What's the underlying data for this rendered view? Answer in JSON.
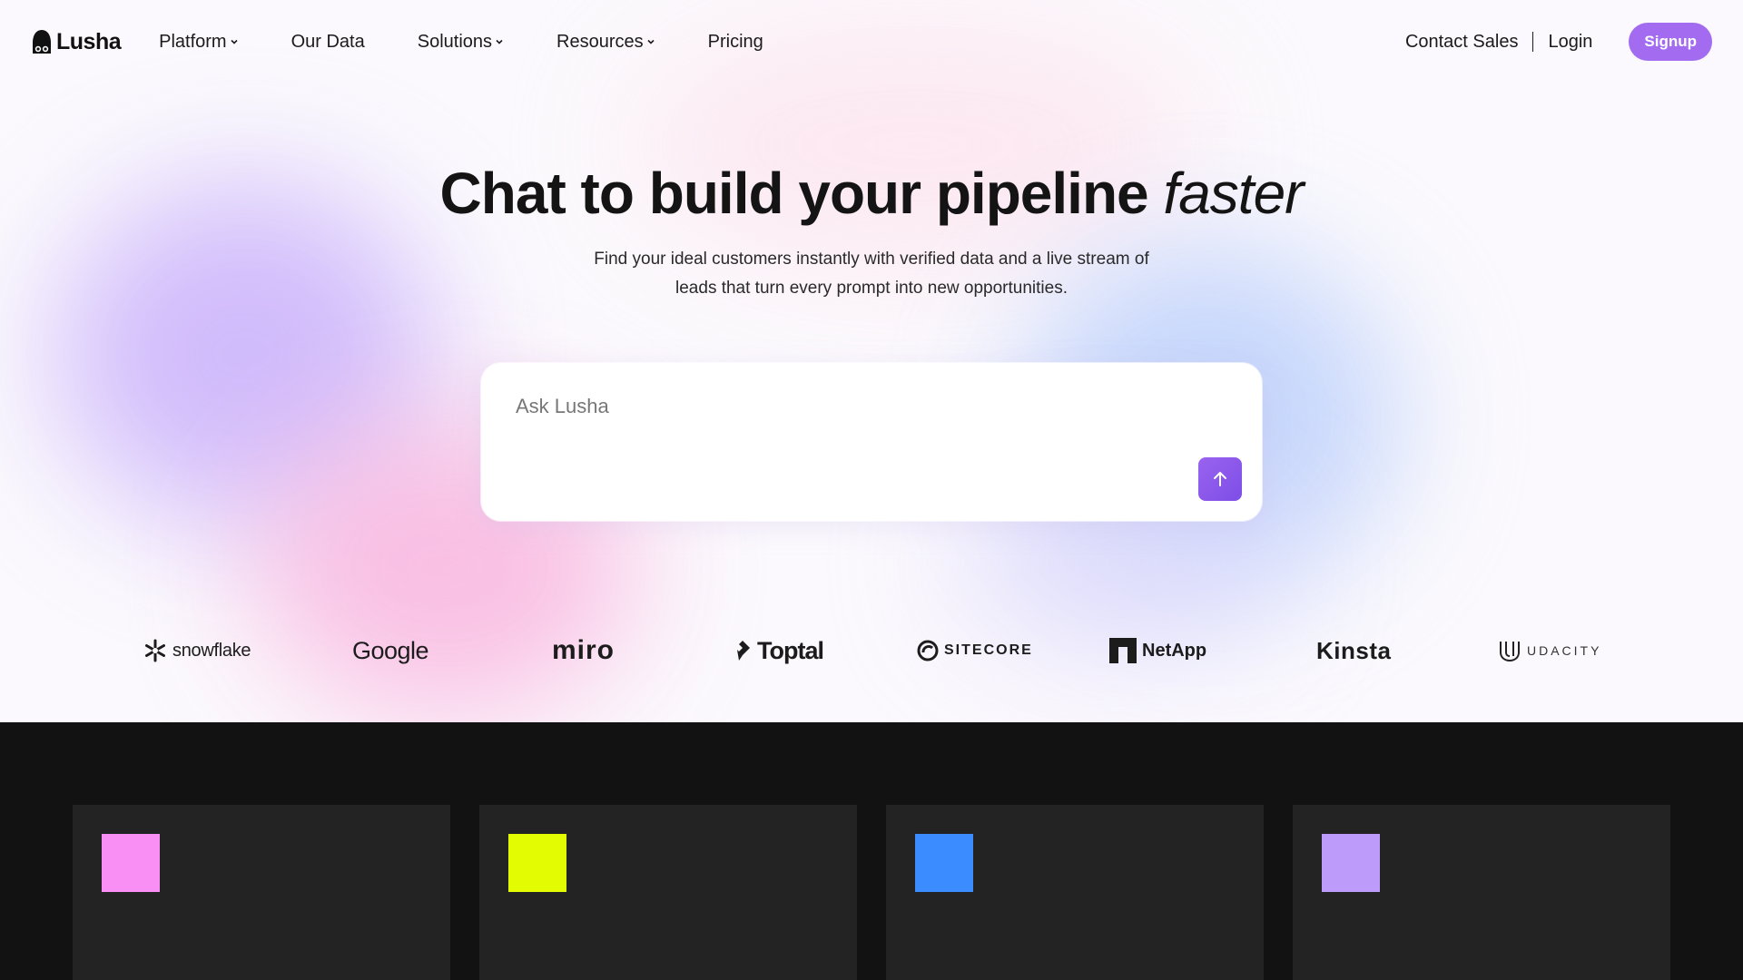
{
  "brand": {
    "name": "Lusha",
    "accent": "#a36bf0"
  },
  "nav": {
    "items": [
      {
        "label": "Platform",
        "dropdown": true
      },
      {
        "label": "Our Data",
        "dropdown": false
      },
      {
        "label": "Solutions",
        "dropdown": true
      },
      {
        "label": "Resources",
        "dropdown": true
      },
      {
        "label": "Pricing",
        "dropdown": false
      }
    ],
    "contact_sales": "Contact Sales",
    "login": "Login",
    "signup": "Signup"
  },
  "hero": {
    "headline": "Chat to build your pipeline",
    "headline_emphasis": "faster",
    "subtitle_line1": "Find your ideal customers instantly with verified data and a live stream of",
    "subtitle_line2": "leads that turn every prompt into new opportunities."
  },
  "chat": {
    "placeholder": "Ask Lusha",
    "send_icon": "arrow-up-icon"
  },
  "customer_logos": [
    "snowflake",
    "Google",
    "miro",
    "Toptal",
    "SITECORE",
    "NetApp",
    "Kinsta",
    "UDACITY"
  ],
  "feature_cards": [
    {
      "swatch_color": "#f98ef5"
    },
    {
      "swatch_color": "#e3fc02"
    },
    {
      "swatch_color": "#3b8cff"
    },
    {
      "swatch_color": "#bc9bfa"
    }
  ]
}
